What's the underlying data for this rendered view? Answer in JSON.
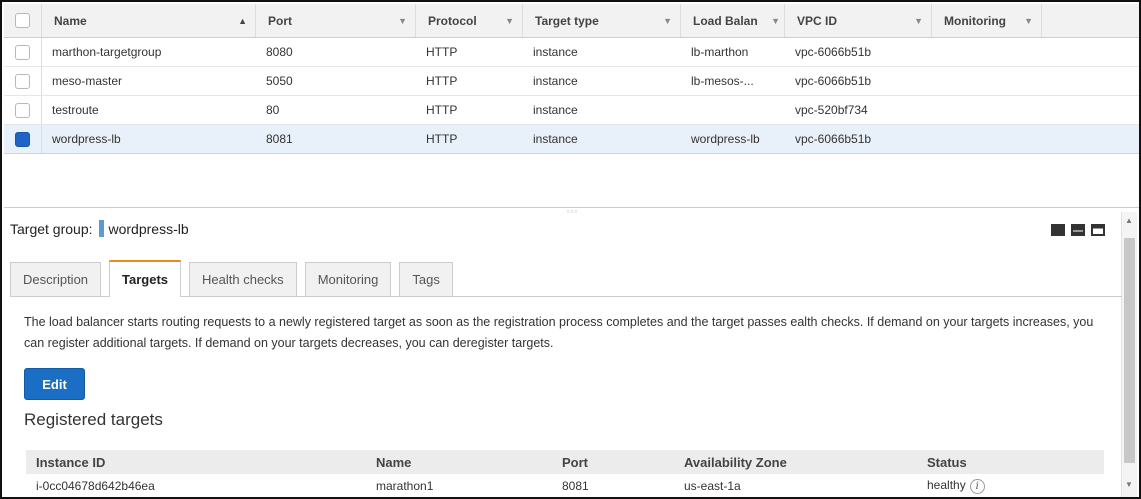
{
  "grid": {
    "columns": [
      "Name",
      "Port",
      "Protocol",
      "Target type",
      "Load Balan",
      "VPC ID",
      "Monitoring"
    ],
    "rows": [
      {
        "name": "marthon-targetgroup",
        "port": "8080",
        "protocol": "HTTP",
        "target_type": "instance",
        "load_balancer": "lb-marthon",
        "vpc_id": "vpc-6066b51b",
        "selected": false
      },
      {
        "name": "meso-master",
        "port": "5050",
        "protocol": "HTTP",
        "target_type": "instance",
        "load_balancer": "lb-mesos-...",
        "vpc_id": "vpc-6066b51b",
        "selected": false
      },
      {
        "name": "testroute",
        "port": "80",
        "protocol": "HTTP",
        "target_type": "instance",
        "load_balancer": "",
        "vpc_id": "vpc-520bf734",
        "selected": false
      },
      {
        "name": "wordpress-lb",
        "port": "8081",
        "protocol": "HTTP",
        "target_type": "instance",
        "load_balancer": "wordpress-lb",
        "vpc_id": "vpc-6066b51b",
        "selected": true
      }
    ]
  },
  "splitter_grip": "▫▫▫",
  "target_group": {
    "label": "Target group:",
    "name": "wordpress-lb"
  },
  "tabs": [
    "Description",
    "Targets",
    "Health checks",
    "Monitoring",
    "Tags"
  ],
  "active_tab": "Targets",
  "targets_panel": {
    "description": "The load balancer starts routing requests to a newly registered target as soon as the registration process completes and the target passes ealth checks. If demand on your targets increases, you can register additional targets. If demand on your targets decreases, you can deregister targets.",
    "edit_label": "Edit",
    "registered_title": "Registered targets",
    "columns": [
      "Instance ID",
      "Name",
      "Port",
      "Availability Zone",
      "Status"
    ],
    "rows": [
      {
        "instance_id": "i-0cc04678d642b46ea",
        "name": "marathon1",
        "port": "8081",
        "zone": "us-east-1a",
        "status": "healthy"
      }
    ]
  },
  "icons": {
    "sort_asc": "▲",
    "sort_desc": "▼",
    "info": "i"
  },
  "colors": {
    "accent_orange": "#e88b17",
    "primary_blue": "#1a6ec4",
    "link_blue": "#1a6bb3",
    "selected_row": "#e8f0f9"
  }
}
